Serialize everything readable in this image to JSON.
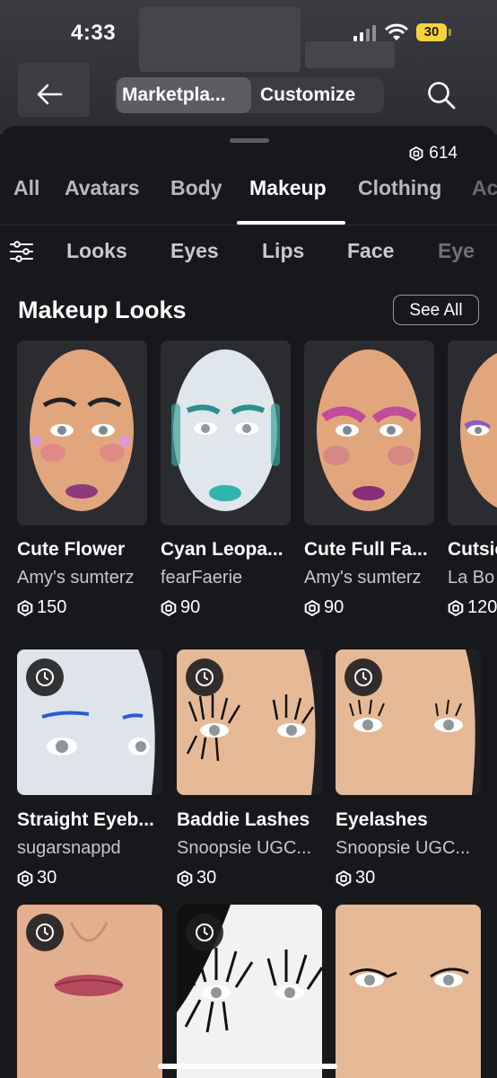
{
  "status": {
    "time": "4:33",
    "battery": "30"
  },
  "header": {
    "tabs": [
      {
        "label": "Marketpla..."
      },
      {
        "label": "Customize"
      }
    ]
  },
  "wallet": {
    "balance": "614"
  },
  "categories": [
    {
      "label": "All"
    },
    {
      "label": "Avatars"
    },
    {
      "label": "Body"
    },
    {
      "label": "Makeup"
    },
    {
      "label": "Clothing"
    },
    {
      "label": "Ac"
    }
  ],
  "subcategories": [
    {
      "label": "Looks"
    },
    {
      "label": "Eyes"
    },
    {
      "label": "Lips"
    },
    {
      "label": "Face"
    },
    {
      "label": "Eye"
    }
  ],
  "section": {
    "title": "Makeup Looks",
    "see_all": "See All"
  },
  "looks": [
    {
      "title": "Cute Flower",
      "creator": "Amy's sumterz",
      "price": "150"
    },
    {
      "title": "Cyan Leopa...",
      "creator": "fearFaerie",
      "price": "90"
    },
    {
      "title": "Cute Full Fa...",
      "creator": "Amy's sumterz",
      "price": "90"
    },
    {
      "title": "Cutsie",
      "creator": "La Bo",
      "price": "120"
    }
  ],
  "items": [
    {
      "title": "Straight Eyeb...",
      "creator": "sugarsnappd",
      "price": "30"
    },
    {
      "title": "Baddie Lashes",
      "creator": "Snoopsie UGC...",
      "price": "30"
    },
    {
      "title": "Eyelashes",
      "creator": "Snoopsie UGC...",
      "price": "30"
    }
  ],
  "colors": {
    "background": "#17181c",
    "text_secondary": "#c6c7ca",
    "skin": "#e8b48e"
  },
  "icons": [
    "back-arrow-icon",
    "search-icon",
    "robux-icon",
    "filter-icon",
    "clock-icon"
  ]
}
